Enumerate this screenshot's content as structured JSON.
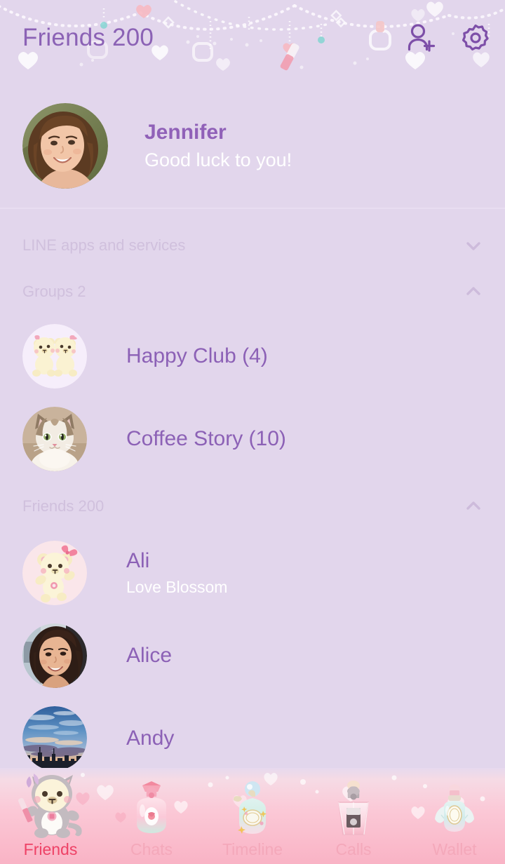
{
  "header": {
    "title": "Friends 200",
    "title_color": "#8b62b5",
    "add_friend_icon": "add-person-icon",
    "settings_icon": "gear-icon"
  },
  "profile": {
    "name": "Jennifer",
    "status_message": "Good luck to you!",
    "avatar_icon": "woman-photo-avatar"
  },
  "sections": {
    "line_apps": {
      "label": "LINE apps and services",
      "chevron": "chevron-down-icon",
      "expanded": false
    },
    "groups": {
      "label": "Groups 2",
      "chevron": "chevron-up-icon",
      "expanded": true
    },
    "friends": {
      "label": "Friends 200",
      "chevron": "chevron-up-icon",
      "expanded": true
    }
  },
  "groups": [
    {
      "name": "Happy Club (4)",
      "avatar_icon": "two-bears-avatar"
    },
    {
      "name": "Coffee Story (10)",
      "avatar_icon": "cat-photo-avatar"
    }
  ],
  "friends": [
    {
      "name": "Ali",
      "status_message": "Love Blossom",
      "avatar_icon": "bear-avatar"
    },
    {
      "name": "Alice",
      "status_message": "",
      "avatar_icon": "woman-photo-avatar"
    },
    {
      "name": "Andy",
      "status_message": "",
      "avatar_icon": "sunset-skyline-avatar"
    }
  ],
  "bottom_nav": {
    "active": "Friends",
    "items": [
      {
        "label": "Friends",
        "icon": "bear-in-cat-costume-icon"
      },
      {
        "label": "Chats",
        "icon": "pink-perfume-bottle-icon"
      },
      {
        "label": "Timeline",
        "icon": "mint-perfume-bottle-icon"
      },
      {
        "label": "Calls",
        "icon": "diamond-perfume-bottle-icon"
      },
      {
        "label": "Wallet",
        "icon": "shell-perfume-bottle-icon"
      }
    ],
    "active_color": "#ee4266",
    "inactive_color": "#f4a8ba"
  },
  "theme": {
    "background": "#e2d6ec",
    "accent_purple": "#8b62b5",
    "muted_label": "#d0c0dd"
  }
}
